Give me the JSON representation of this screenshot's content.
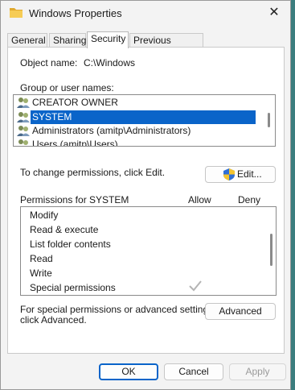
{
  "window": {
    "title": "Windows Properties",
    "close_glyph": "✕"
  },
  "tabs": [
    {
      "label": "General"
    },
    {
      "label": "Sharing"
    },
    {
      "label": "Security"
    },
    {
      "label": "Previous Versions"
    }
  ],
  "object": {
    "label": "Object name:",
    "value": "C:\\Windows"
  },
  "groups": {
    "label": "Group or user names:",
    "items": [
      {
        "label": "CREATOR OWNER",
        "icon": "user-group-icon"
      },
      {
        "label": "SYSTEM",
        "icon": "user-group-icon",
        "selected": true
      },
      {
        "label": "Administrators (amitp\\Administrators)",
        "icon": "user-group-icon"
      },
      {
        "label": "Users (amitp\\Users)",
        "icon": "user-group-icon"
      }
    ]
  },
  "change_text": "To change permissions, click Edit.",
  "edit_button": "Edit...",
  "permissions": {
    "header": "Permissions for SYSTEM",
    "allow_label": "Allow",
    "deny_label": "Deny",
    "items": [
      {
        "label": "Modify"
      },
      {
        "label": "Read & execute"
      },
      {
        "label": "List folder contents"
      },
      {
        "label": "Read"
      },
      {
        "label": "Write"
      },
      {
        "label": "Special permissions",
        "allow": "checked-disabled"
      }
    ]
  },
  "advanced": {
    "line1": "For special permissions or advanced settings,",
    "line2": "click Advanced.",
    "button": "Advanced"
  },
  "footer": {
    "ok": "OK",
    "cancel": "Cancel",
    "apply": "Apply"
  },
  "colors": {
    "selection": "#0a64c9",
    "accent_border": "#0a64c9",
    "folder": "#f2c14b"
  }
}
